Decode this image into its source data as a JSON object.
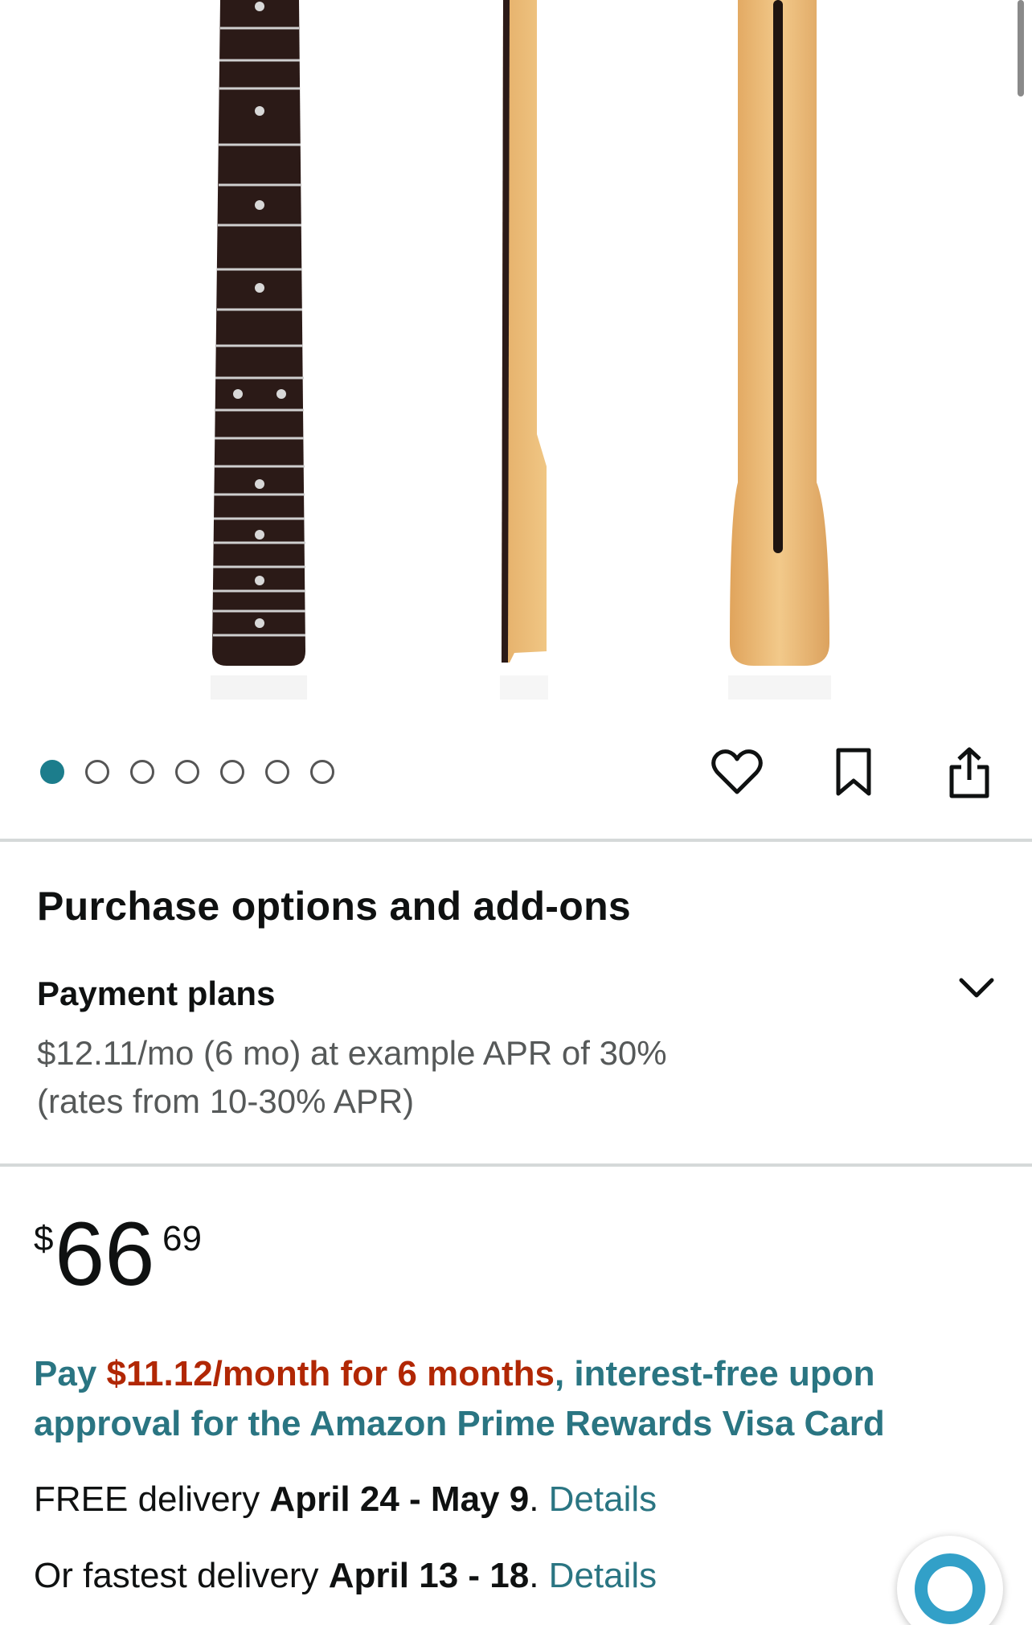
{
  "gallery": {
    "image_count": 7,
    "active_index": 0,
    "actions": [
      "heart-icon",
      "bookmark-icon",
      "share-icon"
    ]
  },
  "purchase_options": {
    "title": "Purchase options and add-ons",
    "payment_plans": {
      "title": "Payment plans",
      "line1": "$12.11/mo (6 mo) at example APR of 30%",
      "line2": "(rates from 10-30% APR)"
    }
  },
  "price": {
    "currency": "$",
    "whole": "66",
    "fraction": "69"
  },
  "promo": {
    "prefix": "Pay ",
    "highlight": "$11.12/month for 6 months",
    "suffix": ", interest-free upon approval for the Amazon Prime Rewards Visa Card"
  },
  "delivery": {
    "free_prefix": "FREE delivery ",
    "free_dates": "April 24 - May 9",
    "free_period": ". ",
    "free_link": "Details",
    "fast_prefix": "Or fastest delivery ",
    "fast_dates": "April 13 - 18",
    "fast_period": ". ",
    "fast_link": "Details"
  },
  "colors": {
    "accent_teal": "#2a7582",
    "price_red": "#b12704",
    "active_dot": "#1c7d8c",
    "assistant_ring": "#32a0c8"
  }
}
